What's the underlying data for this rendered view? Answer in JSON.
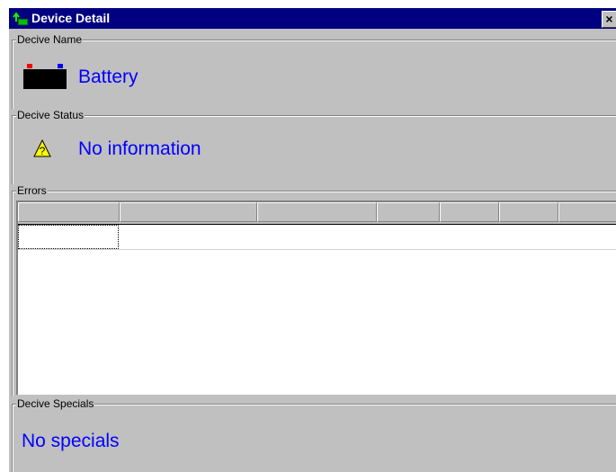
{
  "window": {
    "title": "Device Detail",
    "close_label": "×",
    "icon": "device-app-icon"
  },
  "device_name": {
    "group_label": "Decive Name",
    "value": "Battery",
    "icon": "battery-icon"
  },
  "device_status": {
    "group_label": "Decive Status",
    "value": "No information",
    "icon": "warning-icon"
  },
  "errors": {
    "group_label": "Errors",
    "columns": [
      "",
      "",
      "",
      "",
      "",
      "",
      ""
    ],
    "rows": [
      [
        "",
        "",
        "",
        "",
        "",
        "",
        ""
      ]
    ]
  },
  "device_specials": {
    "group_label": "Decive Specials",
    "value": "No specials"
  },
  "colors": {
    "titlebar": "#000080",
    "face": "#c0c0c0",
    "accent_text": "#0000ff"
  }
}
